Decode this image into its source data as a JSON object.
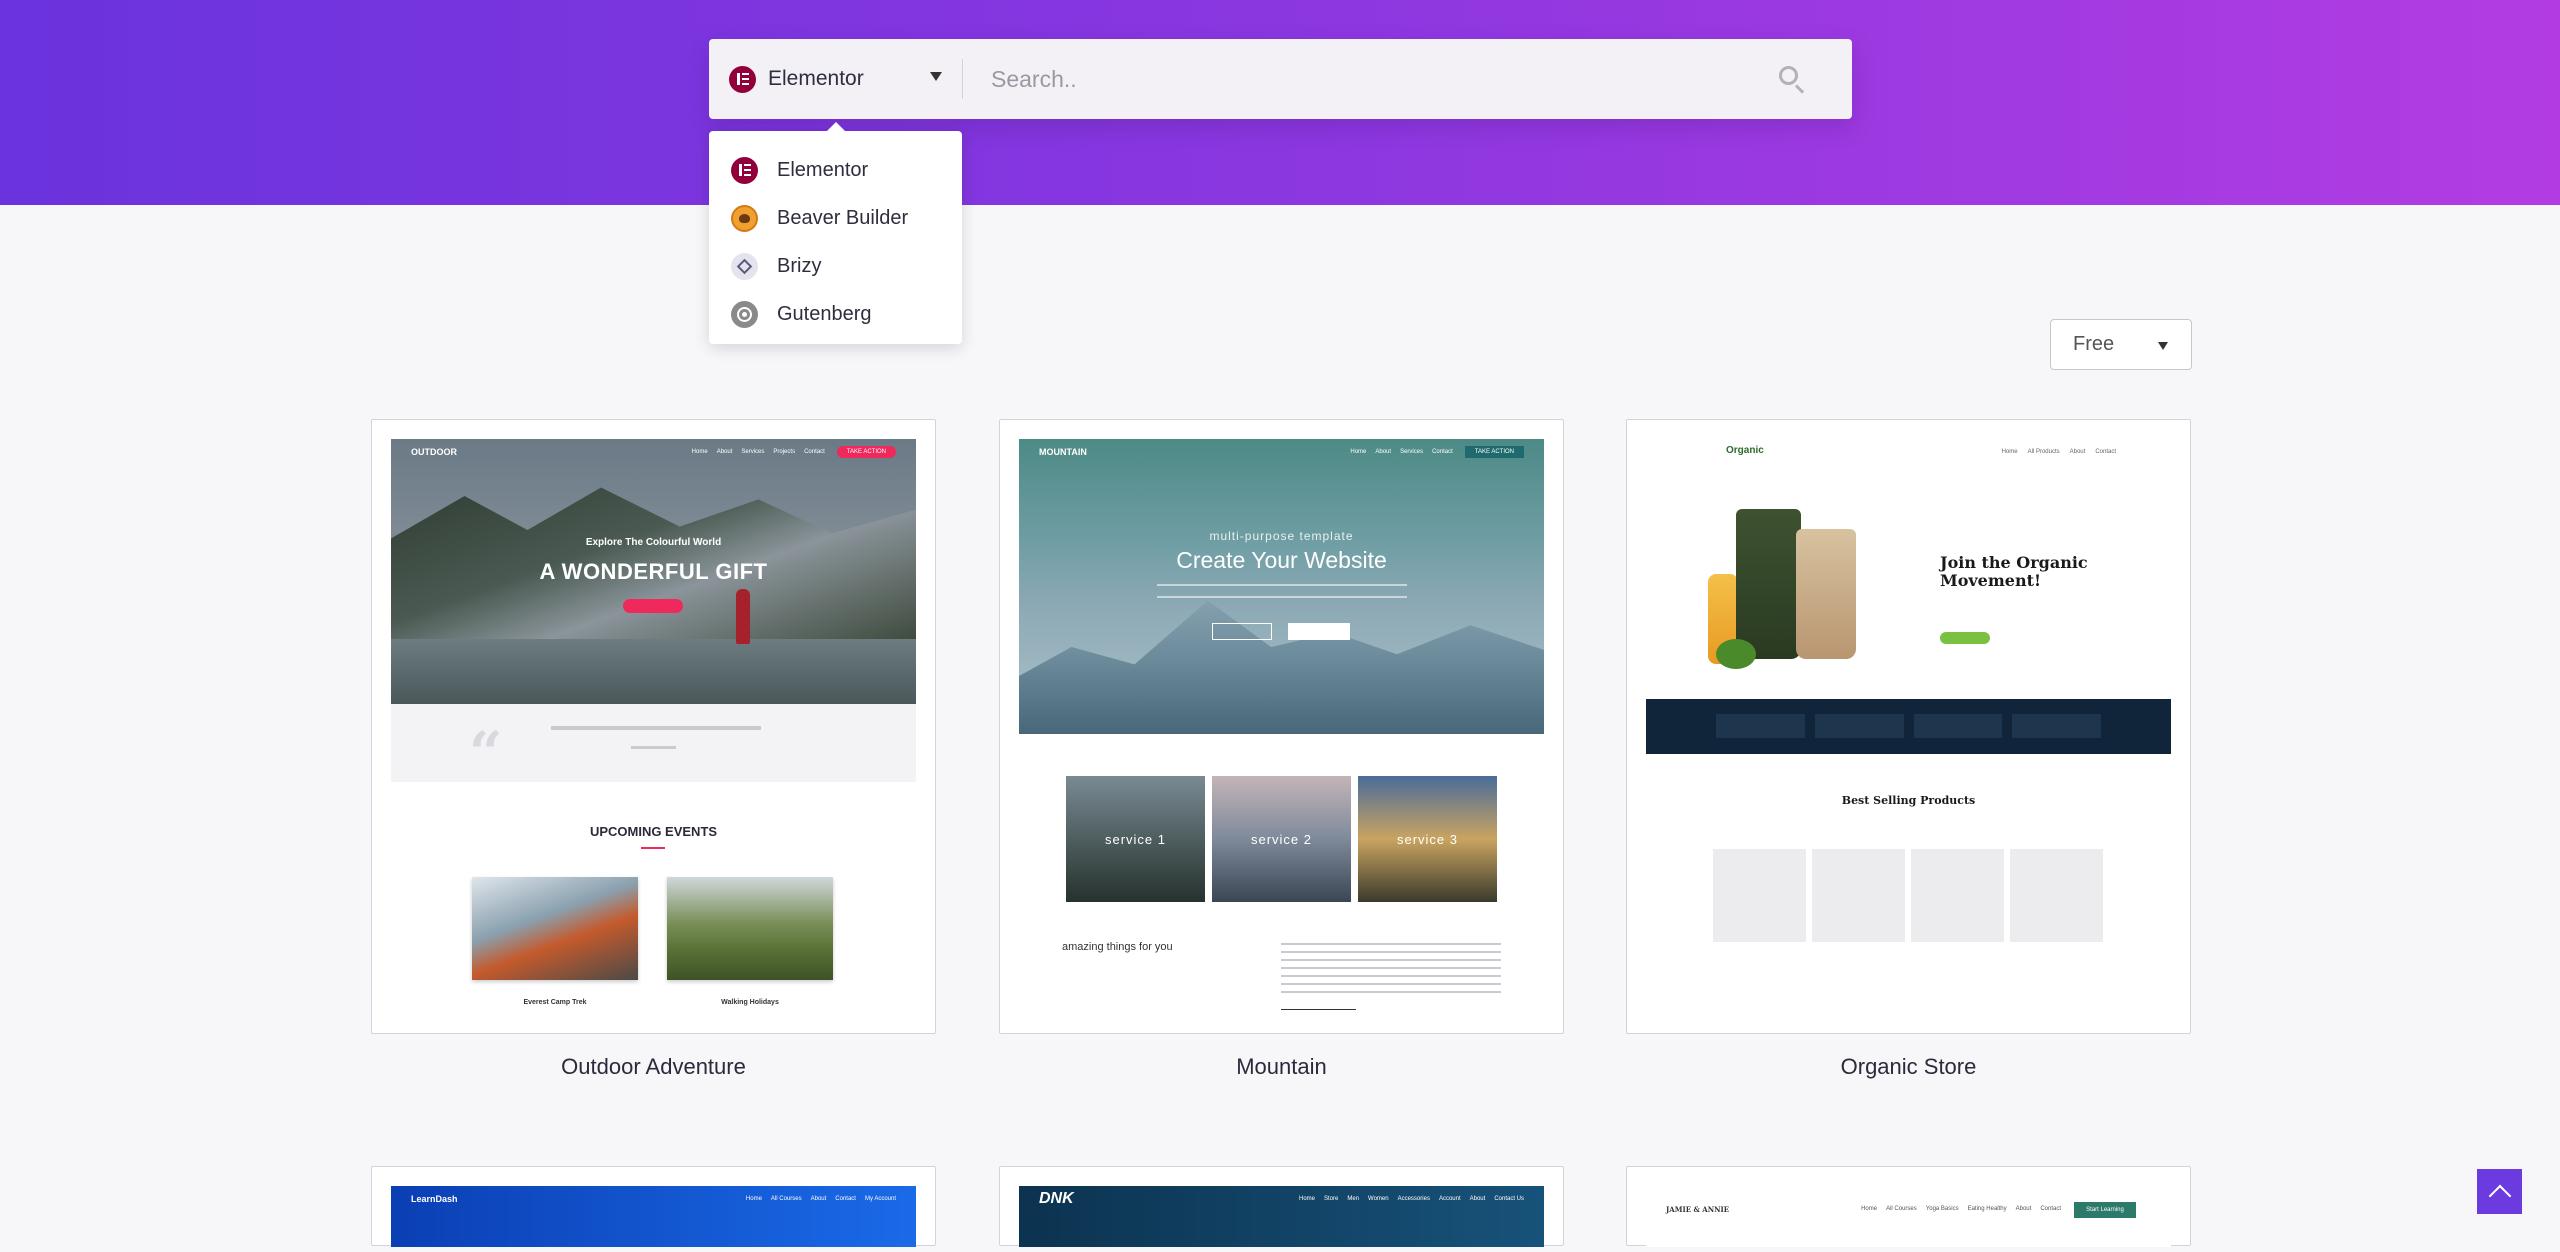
{
  "builder_select": {
    "selected": "Elementor",
    "icon": "elementor-icon"
  },
  "search": {
    "placeholder": "Search..",
    "value": ""
  },
  "dropdown": {
    "items": [
      {
        "label": "Elementor",
        "icon": "elementor-icon"
      },
      {
        "label": "Beaver Builder",
        "icon": "beaver-builder-icon"
      },
      {
        "label": "Brizy",
        "icon": "brizy-icon"
      },
      {
        "label": "Gutenberg",
        "icon": "gutenberg-icon"
      }
    ]
  },
  "filter": {
    "selected": "Free"
  },
  "templates": [
    {
      "title": "Outdoor Adventure",
      "preview": {
        "logo": "OUTDOOR",
        "nav": [
          "Home",
          "About",
          "Services",
          "Projects",
          "Contact"
        ],
        "cta": "TAKE ACTION",
        "subheading": "Explore The Colourful World",
        "heading": "A WONDERFUL GIFT",
        "section_title": "UPCOMING EVENTS",
        "events": [
          "Everest Camp Trek",
          "Walking Holidays"
        ]
      }
    },
    {
      "title": "Mountain",
      "preview": {
        "logo": "MOUNTAIN",
        "nav": [
          "Home",
          "About",
          "Services",
          "Contact"
        ],
        "cta": "TAKE ACTION",
        "subheading": "multi-purpose template",
        "heading": "Create Your Website",
        "services": [
          "service 1",
          "service 2",
          "service 3"
        ],
        "tagline": "amazing things for you"
      }
    },
    {
      "title": "Organic Store",
      "preview": {
        "logo": "Organic",
        "nav": [
          "Home",
          "All Products",
          "About",
          "Contact"
        ],
        "heading": "Join the Organic Movement!",
        "section_title": "Best Selling Products"
      }
    },
    {
      "title": "",
      "preview": {
        "logo": "LearnDash",
        "nav": [
          "Home",
          "All Courses",
          "About",
          "Contact",
          "My Account"
        ]
      }
    },
    {
      "title": "",
      "preview": {
        "logo": "DNK",
        "nav": [
          "Home",
          "Store",
          "Men",
          "Women",
          "Accessories",
          "Account",
          "About",
          "Contact Us"
        ]
      }
    },
    {
      "title": "",
      "preview": {
        "logo": "JAMIE & ANNIE",
        "nav": [
          "Home",
          "All Courses",
          "Yoga Basics",
          "Eating Healthy",
          "About",
          "Contact"
        ],
        "cta": "Start Learning"
      }
    }
  ],
  "colors": {
    "hero_start": "#6a33dd",
    "hero_end": "#b23ce2",
    "accent": "#6c3be0",
    "elementor": "#92003b"
  }
}
